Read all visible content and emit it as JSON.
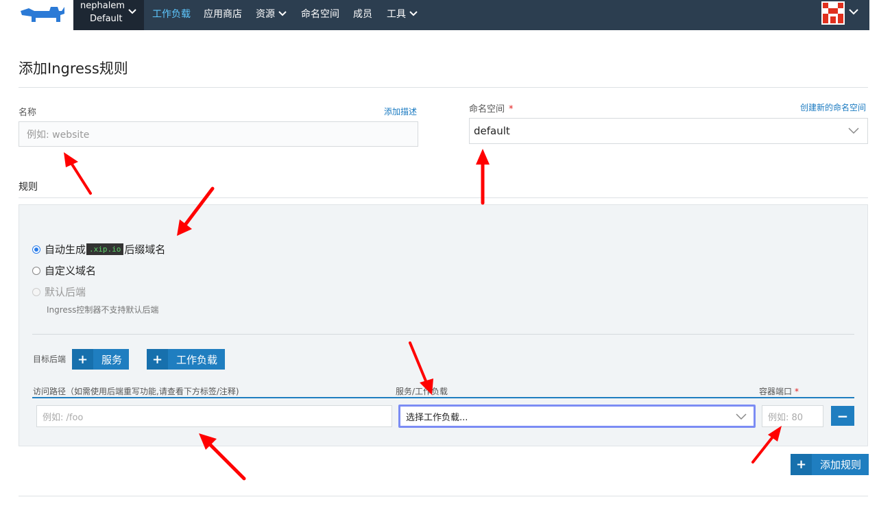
{
  "header": {
    "project_name": "nephalem",
    "project_env": "Default",
    "nav": [
      {
        "label": "工作负载",
        "active": true
      },
      {
        "label": "应用商店"
      },
      {
        "label": "资源"
      },
      {
        "label": "命名空间"
      },
      {
        "label": "成员"
      },
      {
        "label": "工具"
      }
    ]
  },
  "page_title": "添加Ingress规则",
  "name_field": {
    "label": "名称",
    "placeholder": "例如: website",
    "add_desc_link": "添加描述"
  },
  "namespace_field": {
    "label": "命名空间",
    "required_mark": "*",
    "value": "default",
    "create_link": "创建新的命名空间"
  },
  "rules": {
    "section_label": "规则",
    "options": [
      {
        "prefix": "自动生成",
        "code": ".xip.io",
        "suffix": "后缀域名",
        "selected": true
      },
      {
        "label": "自定义域名"
      },
      {
        "label": "默认后端",
        "disabled": true
      }
    ],
    "default_backend_note": "Ingress控制器不支持默认后端",
    "target_backend_label": "目标后端",
    "add_service_btn": "服务",
    "add_workload_btn": "工作负载",
    "col_path": "访问路径（如需使用后端重写功能,请查看下方标签/注释)",
    "col_service": "服务/工作负载",
    "col_port": "容器端口",
    "col_port_required": "*",
    "path_placeholder": "例如: /foo",
    "workload_placeholder": "选择工作负载...",
    "port_placeholder": "例如: 80",
    "add_rule_btn": "添加规则"
  },
  "colors": {
    "header_bg": "#2c3e50",
    "accent": "#1f7ec0",
    "annotation_arrow": "#ff0000"
  }
}
